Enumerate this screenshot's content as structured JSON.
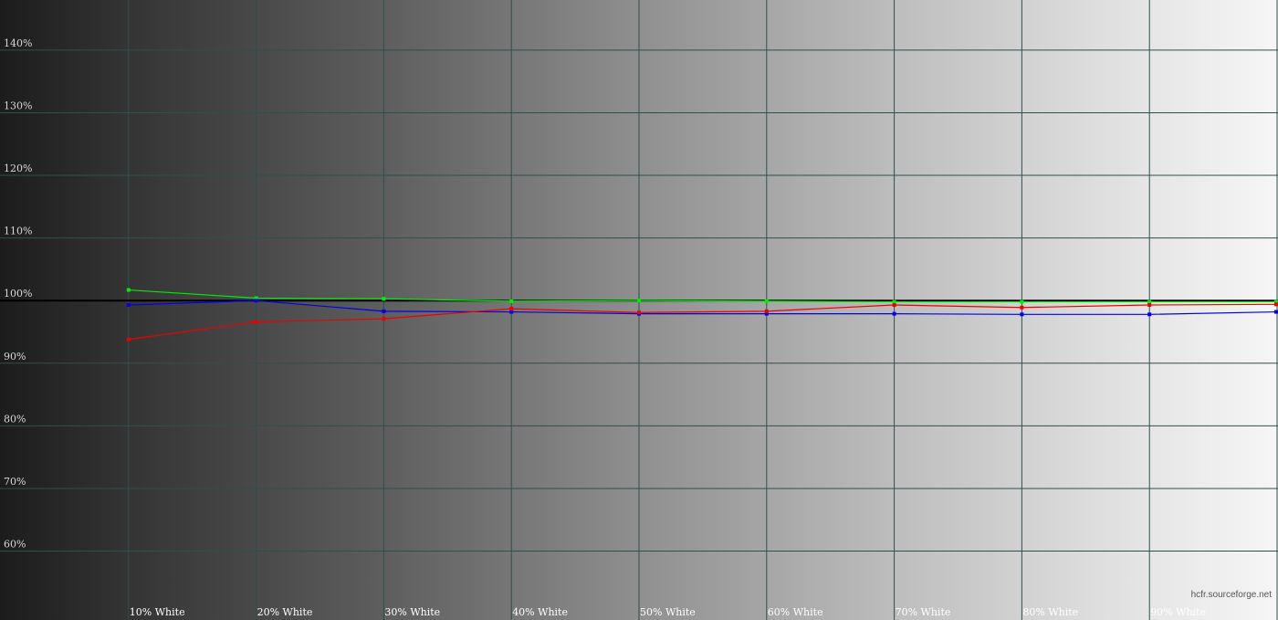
{
  "chart_data": {
    "type": "line",
    "title": "",
    "xlabel": "",
    "ylabel": "",
    "categories": [
      "",
      "10% White",
      "20% White",
      "30% White",
      "40% White",
      "50% White",
      "60% White",
      "70% White",
      "80% White",
      "90% White",
      ""
    ],
    "y_ticks": [
      {
        "value": 60,
        "label": "60%"
      },
      {
        "value": 70,
        "label": "70%"
      },
      {
        "value": 80,
        "label": "80%"
      },
      {
        "value": 90,
        "label": "90%"
      },
      {
        "value": 100,
        "label": "100%"
      },
      {
        "value": 110,
        "label": "110%"
      },
      {
        "value": 120,
        "label": "120%"
      },
      {
        "value": 130,
        "label": "130%"
      },
      {
        "value": 140,
        "label": "140%"
      }
    ],
    "ylim": [
      49,
      148
    ],
    "reference_value": 100,
    "grid": true,
    "series": [
      {
        "color": "#00ee00",
        "values": [
          null,
          101.7,
          100.4,
          100.3,
          99.9,
          100.0,
          99.9,
          99.8,
          99.8,
          99.8,
          99.8
        ]
      },
      {
        "color": "#0000ee",
        "values": [
          null,
          99.3,
          100.0,
          98.3,
          98.2,
          97.9,
          97.9,
          97.9,
          97.8,
          97.8,
          98.2
        ]
      },
      {
        "color": "#ee0000",
        "values": [
          null,
          93.8,
          96.6,
          97.1,
          98.7,
          98.1,
          98.3,
          99.3,
          98.9,
          99.3,
          99.4
        ]
      }
    ]
  },
  "watermark": "hcfr.sourceforge.net"
}
